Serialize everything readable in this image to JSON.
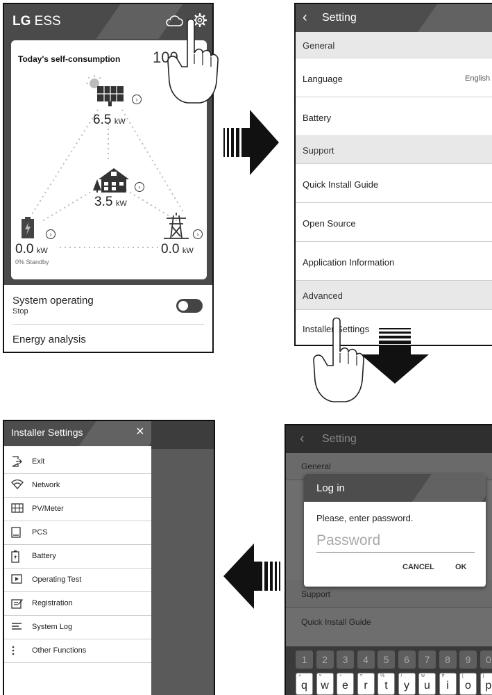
{
  "p1": {
    "app_title_bold": "LG",
    "app_title_rest": "ESS",
    "self_consumption_label": "Today's self-consumption",
    "self_consumption_value": "100",
    "pv_value": "6.5",
    "load_value": "3.5",
    "battery_value": "0.0",
    "battery_status": "0% Standby",
    "grid_value": "0.0",
    "unit": "kW",
    "system_operating_label": "System operating",
    "system_operating_status": "Stop",
    "system_operating_on": false,
    "energy_analysis_label": "Energy analysis"
  },
  "p2": {
    "title": "Setting",
    "general": "General",
    "language_label": "Language",
    "language_value": "English",
    "battery": "Battery",
    "support": "Support",
    "quick_install": "Quick Install Guide",
    "open_source": "Open Source",
    "app_info": "Application Information",
    "advanced": "Advanced",
    "installer_settings": "Installer Settings"
  },
  "p3": {
    "title": "Installer Settings",
    "menu": [
      {
        "label": "Exit",
        "icon": "exit-icon"
      },
      {
        "label": "Network",
        "icon": "wifi-icon"
      },
      {
        "label": "PV/Meter",
        "icon": "solar-panel-icon"
      },
      {
        "label": "PCS",
        "icon": "pcs-icon"
      },
      {
        "label": "Battery",
        "icon": "battery-icon"
      },
      {
        "label": "Operating Test",
        "icon": "play-icon"
      },
      {
        "label": "Registration",
        "icon": "registration-icon"
      },
      {
        "label": "System Log",
        "icon": "list-icon"
      },
      {
        "label": "Other Functions",
        "icon": "more-vertical-icon"
      }
    ]
  },
  "p4": {
    "title": "Setting",
    "general": "General",
    "support": "Support",
    "quick_install": "Quick Install Guide",
    "dialog": {
      "title": "Log in",
      "message": "Please, enter password.",
      "placeholder": "Password",
      "cancel": "CANCEL",
      "ok": "OK"
    },
    "number_keys": [
      "1",
      "2",
      "3",
      "4",
      "5",
      "6",
      "7",
      "8",
      "9",
      "0"
    ],
    "letter_keys": [
      "q",
      "w",
      "e",
      "r",
      "t",
      "y",
      "u",
      "i",
      "o",
      "p"
    ],
    "letter_hints": [
      "+",
      "×",
      "÷",
      "=",
      "%",
      "/",
      "w",
      "#",
      "[",
      "]"
    ]
  },
  "colors": {
    "header_dark": "#4d4d4d",
    "section_gray": "#e8e8e8",
    "toggle_dark": "#444444",
    "keyboard_key": "#5e5e5e"
  }
}
